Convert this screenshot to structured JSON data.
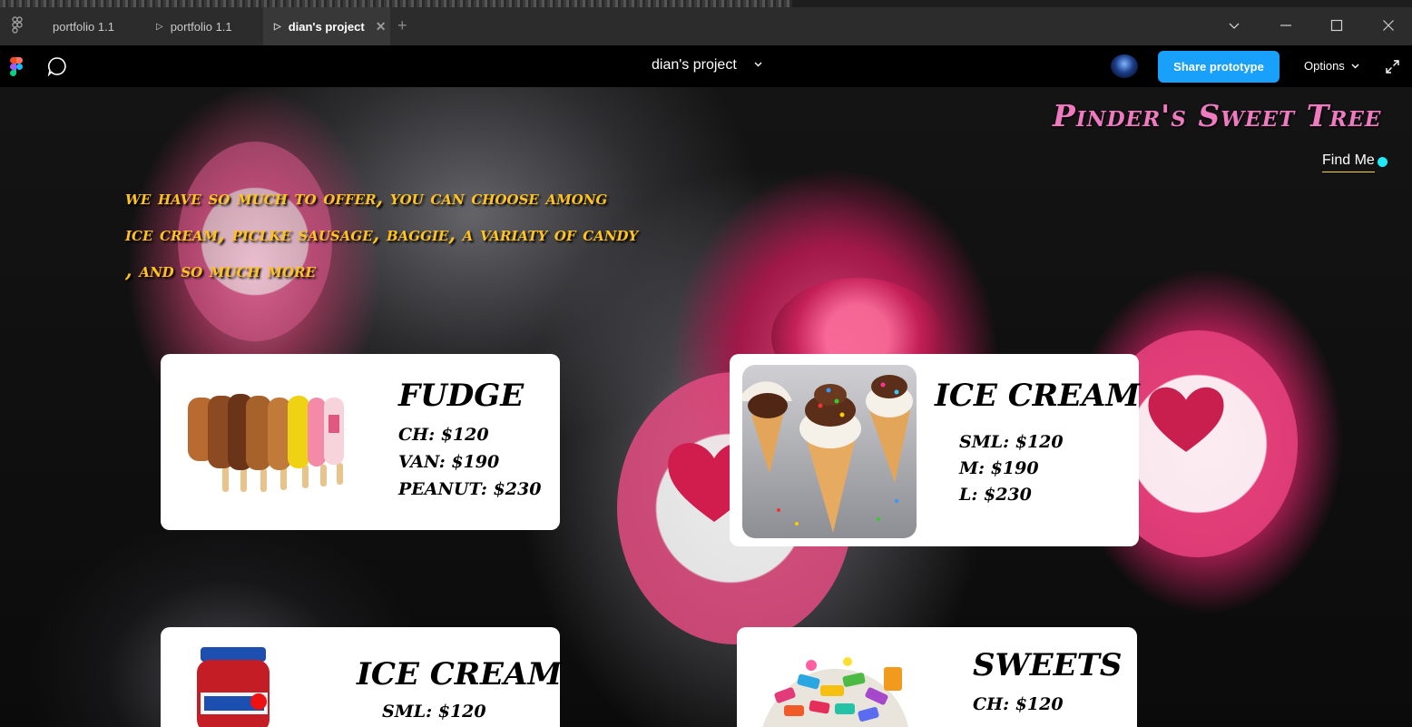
{
  "tabs": [
    {
      "label": "portfolio 1.1",
      "has_play": false,
      "active": false
    },
    {
      "label": "portfolio 1.1",
      "has_play": true,
      "active": false
    },
    {
      "label": "dian's project",
      "has_play": true,
      "active": true
    }
  ],
  "toolbar": {
    "project_title": "dian's project",
    "share_label": "Share prototype",
    "options_label": "Options"
  },
  "site": {
    "title": "Pinder's Sweet Tree",
    "nav_link": "Find Me",
    "intro_lines": [
      "We have so much to offer, you can choose among",
      "ice cream, piclke sausage, baggie, a variaty of candy",
      ", and so much more"
    ]
  },
  "cards": [
    {
      "title": "FUDGE",
      "prices": [
        "CH: $120",
        "VAN: $190",
        "PEANUT: $230"
      ],
      "image": "popsicles-image"
    },
    {
      "title": "ICE CREAM",
      "prices": [
        "SML: $120",
        "M: $190",
        "L: $230"
      ],
      "image": "ice-cream-cones-image"
    },
    {
      "title": "ICE CREAM",
      "prices": [
        "SML: $120"
      ],
      "image": "red-candy-jar-image"
    },
    {
      "title": "SWEETS",
      "prices": [
        "CH: $120"
      ],
      "image": "candy-pile-image"
    }
  ],
  "colors": {
    "title_pink": "#f07ac0",
    "intro_yellow": "#ffc21e",
    "share_blue": "#18a0fb",
    "dot_cyan": "#1ee9f5"
  }
}
